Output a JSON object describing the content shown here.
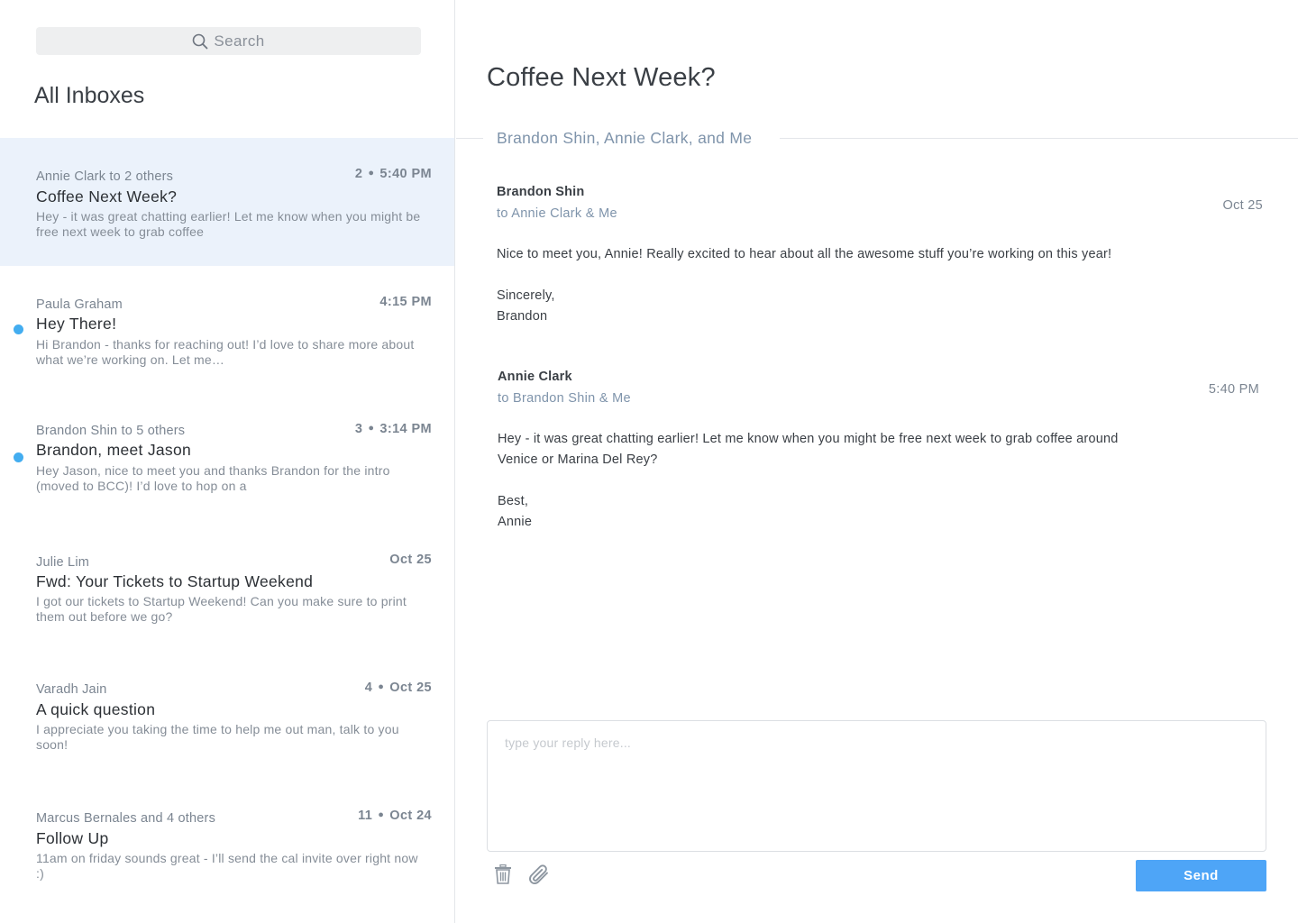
{
  "search": {
    "placeholder": "Search"
  },
  "sidebar": {
    "title": "All Inboxes",
    "messages": [
      {
        "sender": "Annie Clark to 2 others",
        "count": "2",
        "time": "5:40 PM",
        "subject": "Coffee Next Week?",
        "preview": "Hey - it was great chatting earlier! Let me know when you might be free next week to grab coffee",
        "selected": true,
        "unread": false
      },
      {
        "sender": "Paula Graham",
        "count": "",
        "time": "4:15 PM",
        "subject": "Hey There!",
        "preview": "Hi Brandon - thanks for reaching out! I’d love to share more about what we’re working on. Let me…",
        "selected": false,
        "unread": true
      },
      {
        "sender": "Brandon Shin to 5 others",
        "count": "3",
        "time": "3:14 PM",
        "subject": "Brandon, meet Jason",
        "preview": "Hey Jason, nice to meet you and thanks Brandon for the intro (moved to BCC)! I’d love to hop on a",
        "selected": false,
        "unread": true
      },
      {
        "sender": "Julie Lim",
        "count": "",
        "time": "Oct 25",
        "subject": "Fwd: Your Tickets to Startup Weekend",
        "preview": "I got our tickets to Startup Weekend! Can you make sure to print them out before we go?",
        "selected": false,
        "unread": false
      },
      {
        "sender": "Varadh Jain",
        "count": "4",
        "time": "Oct 25",
        "subject": "A quick question",
        "preview": "I appreciate you taking the time to help me out man, talk to you soon!",
        "selected": false,
        "unread": false
      },
      {
        "sender": "Marcus Bernales and 4 others",
        "count": "11",
        "time": "Oct 24",
        "subject": "Follow Up",
        "preview": "11am on friday sounds great - I’ll send the cal invite over right now :)",
        "selected": false,
        "unread": false
      }
    ]
  },
  "thread": {
    "title": "Coffee Next Week?",
    "participants": "Brandon Shin, Annie Clark, and Me",
    "emails": [
      {
        "from": "Brandon Shin",
        "to": "to Annie Clark & Me",
        "time": "Oct 25",
        "body": [
          "Nice to meet you, Annie! Really excited to hear about all the awesome stuff you’re working on this year!",
          "",
          "Sincerely,",
          "Brandon"
        ]
      },
      {
        "from": "Annie Clark",
        "to": "to Brandon Shin & Me",
        "time": "5:40 PM",
        "body": [
          "Hey - it was great chatting earlier! Let me know when you might be free next week to grab coffee around",
          "Venice or Marina Del Rey?",
          "",
          "Best,",
          "Annie"
        ]
      }
    ]
  },
  "reply": {
    "placeholder": "type your reply here...",
    "send_label": "Send",
    "icons": {
      "delete": "trash-icon",
      "attach": "paperclip-icon"
    }
  },
  "colors": {
    "accent": "#4ea5f7",
    "unread_dot": "#43adf0",
    "selected_bg": "#ebf2fb"
  }
}
